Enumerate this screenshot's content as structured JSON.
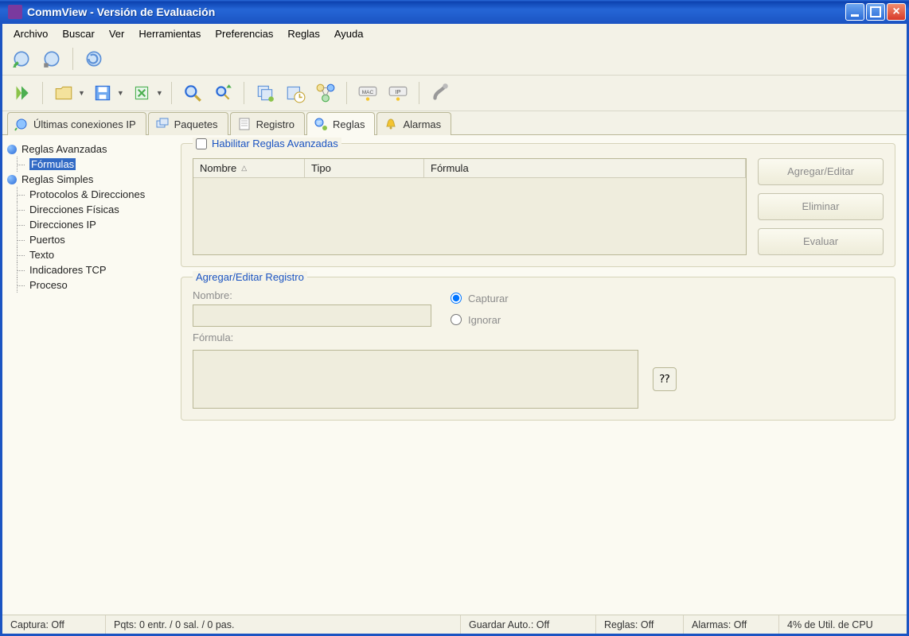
{
  "window": {
    "title": "CommView - Versión de Evaluación"
  },
  "menu": [
    "Archivo",
    "Buscar",
    "Ver",
    "Herramientas",
    "Preferencias",
    "Reglas",
    "Ayuda"
  ],
  "tabs": [
    {
      "label": "Últimas conexiones IP",
      "active": false
    },
    {
      "label": "Paquetes",
      "active": false
    },
    {
      "label": "Registro",
      "active": false
    },
    {
      "label": "Reglas",
      "active": true
    },
    {
      "label": "Alarmas",
      "active": false
    }
  ],
  "tree": {
    "parents": [
      {
        "label": "Reglas Avanzadas",
        "children": [
          "Fórmulas"
        ],
        "selectedChild": 0
      },
      {
        "label": "Reglas Simples",
        "children": [
          "Protocolos & Direcciones",
          "Direcciones Físicas",
          "Direcciones IP",
          "Puertos",
          "Texto",
          "Indicadores TCP",
          "Proceso"
        ]
      }
    ]
  },
  "panel": {
    "enableLabel": "Habilitar Reglas Avanzadas",
    "enableChecked": false,
    "columns": {
      "name": "Nombre",
      "type": "Tipo",
      "formula": "Fórmula"
    },
    "buttons": {
      "addEdit": "Agregar/Editar",
      "delete": "Eliminar",
      "evaluate": "Evaluar"
    },
    "editSection": {
      "title": "Agregar/Editar Registro",
      "nameLabel": "Nombre:",
      "nameValue": "",
      "formulaLabel": "Fórmula:",
      "formulaValue": "",
      "radioCapture": "Capturar",
      "radioIgnore": "Ignorar",
      "radioSelected": "capture"
    }
  },
  "status": {
    "capture": "Captura: Off",
    "packets": "Pqts: 0 entr. / 0 sal. / 0 pas.",
    "autosave": "Guardar Auto.: Off",
    "rules": "Reglas: Off",
    "alarms": "Alarmas: Off",
    "cpu": "4% de Util. de CPU"
  }
}
